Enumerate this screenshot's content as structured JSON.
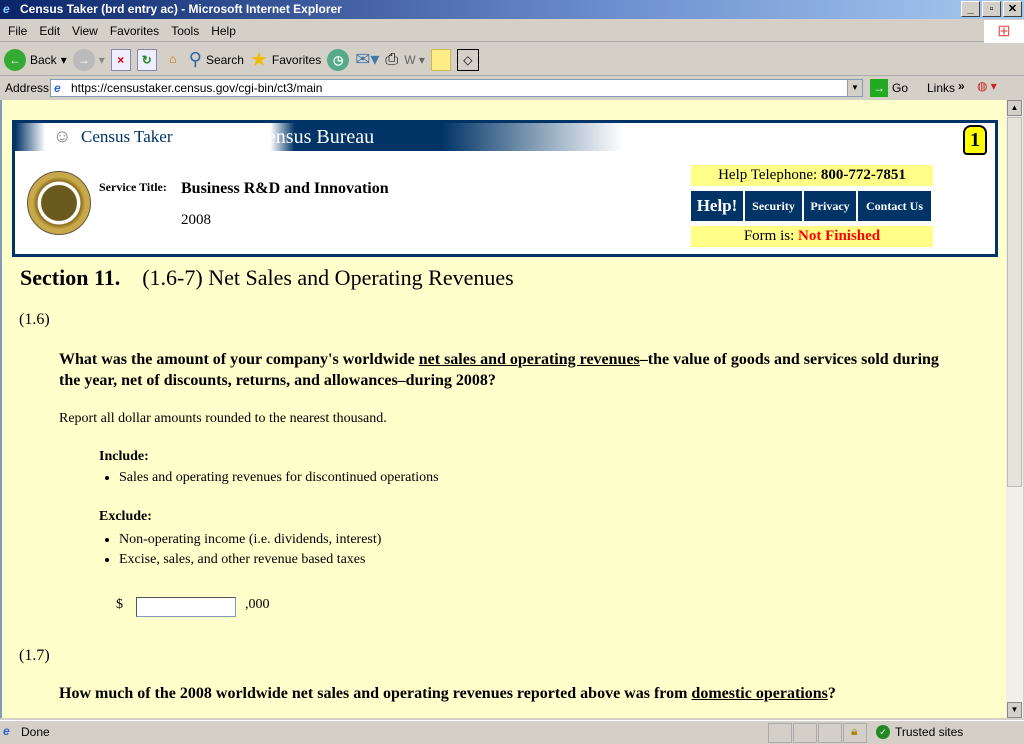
{
  "window": {
    "title": "Census Taker (brd entry ac) - Microsoft Internet Explorer",
    "controls": [
      "_",
      "▫",
      "✕"
    ]
  },
  "menu": [
    "File",
    "Edit",
    "View",
    "Favorites",
    "Tools",
    "Help"
  ],
  "toolbar": {
    "back": "Back",
    "search": "Search",
    "favorites": "Favorites"
  },
  "address": {
    "label": "Address",
    "url": "https://censustaker.census.gov/cgi-bin/ct3/main",
    "go": "Go",
    "links": "Links"
  },
  "header": {
    "app_name": "Census Taker",
    "bureau": "U. S. Census Bureau",
    "service_label": "Service Title:",
    "service_title": "Business R&D and Innovation",
    "year": "2008",
    "help_phone_label": "Help Telephone:",
    "help_phone": "800-772-7851",
    "buttons": [
      "Help!",
      "Security",
      "Privacy",
      "Contact Us"
    ],
    "form_status_label": "Form is:",
    "form_status": "Not Finished",
    "status_color": "#ff0000"
  },
  "section": {
    "number": "Section 11.",
    "title": "(1.6-7) Net Sales and Operating Revenues"
  },
  "q16": {
    "id": "(1.6)",
    "question_pre": "What was the amount of your company's worldwide ",
    "question_link": "net sales and operating revenues",
    "question_post": "–the value of goods and services sold during the year, net of discounts, returns, and allowances–during 2008?",
    "note": "Report all dollar amounts rounded to the nearest thousand.",
    "include_label": "Include:",
    "include": [
      "Sales and operating revenues for discontinued operations"
    ],
    "exclude_label": "Exclude:",
    "exclude": [
      "Non-operating income (i.e. dividends, interest)",
      "Excise, sales, and other revenue based taxes"
    ],
    "currency": "$",
    "value": "",
    "suffix": ",000"
  },
  "q17": {
    "id": "(1.7)",
    "question_pre": "How much of the 2008 worldwide net sales and operating revenues reported above was from ",
    "question_link": "domestic operations",
    "question_post": "?"
  },
  "statusbar": {
    "text": "Done",
    "zone": "Trusted sites"
  }
}
